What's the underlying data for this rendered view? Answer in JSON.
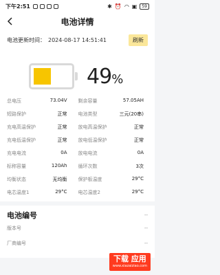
{
  "status_bar": {
    "time": "下午2:51",
    "battery": "59"
  },
  "header": {
    "title": "电池详情"
  },
  "update": {
    "label": "电池更新时间：",
    "value": "2024-08-17 14:51:41",
    "refresh_label": "刷新"
  },
  "battery": {
    "percent_number": "49",
    "percent_sign": "%",
    "level": 0.49
  },
  "details": [
    [
      {
        "k": "总电压",
        "v": "73.04V"
      },
      {
        "k": "剩余容量",
        "v": "57.05AH"
      }
    ],
    [
      {
        "k": "短路保护",
        "v": "正常"
      },
      {
        "k": "电池类型",
        "v": "三元(20串)"
      }
    ],
    [
      {
        "k": "充电高温保护",
        "v": "正常"
      },
      {
        "k": "放电高温保护",
        "v": "正常"
      }
    ],
    [
      {
        "k": "充电低温保护",
        "v": "正常"
      },
      {
        "k": "放电低温保护",
        "v": "正常"
      }
    ],
    [
      {
        "k": "充电电流",
        "v": "0A"
      },
      {
        "k": "放电电流",
        "v": "0A"
      }
    ],
    [
      {
        "k": "标称容量",
        "v": "120Ah"
      },
      {
        "k": "循环次数",
        "v": "3次"
      }
    ],
    [
      {
        "k": "均衡状态",
        "v": "无均衡"
      },
      {
        "k": "保护板温度",
        "v": "29°C"
      }
    ],
    [
      {
        "k": "电芯温度1",
        "v": "29°C"
      },
      {
        "k": "电芯温度2",
        "v": "29°C"
      }
    ]
  ],
  "battery_number": {
    "title": "电池编号",
    "title_value": "--",
    "rows": [
      {
        "k": "版本号",
        "v": "--"
      },
      {
        "k": "厂商编号",
        "v": "--"
      }
    ]
  },
  "watermark": {
    "main": "下载 应用",
    "sub": "www.xiazaiziao.com"
  }
}
